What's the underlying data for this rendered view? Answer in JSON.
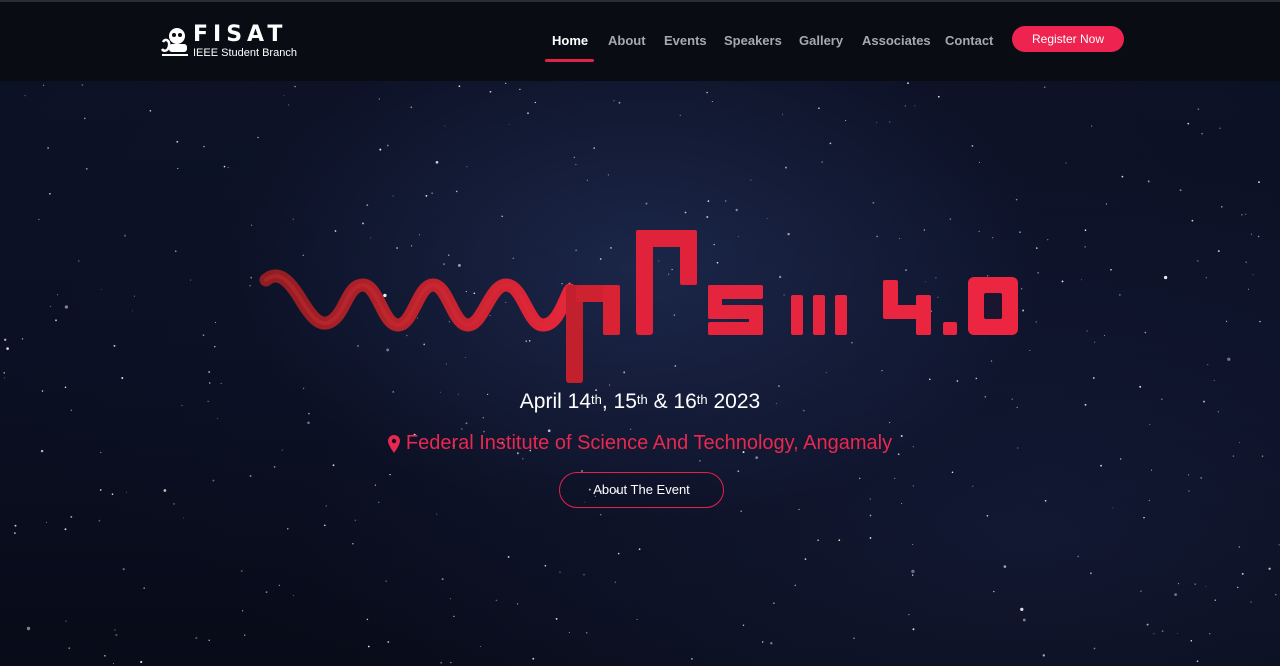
{
  "brand": {
    "name": "FISAT",
    "subtitle": "IEEE Student Branch",
    "logo_icon": "ieee-robot-logo-icon"
  },
  "nav": {
    "items": [
      {
        "label": "Home",
        "active": true
      },
      {
        "label": "About",
        "active": false
      },
      {
        "label": "Events",
        "active": false
      },
      {
        "label": "Speakers",
        "active": false
      },
      {
        "label": "Gallery",
        "active": false
      },
      {
        "label": "Associates",
        "active": false
      },
      {
        "label": "Contact",
        "active": false
      }
    ],
    "register_label": "Register Now"
  },
  "hero": {
    "title_logo_text": "Pulse 4.0",
    "dates": {
      "month": "April",
      "day1": "14",
      "day2": "15",
      "day3": "16",
      "suffix": "th",
      "year": "2023"
    },
    "venue": "Federal Institute of Science And Technology, Angamaly",
    "venue_icon": "map-pin-icon",
    "about_button": "About The Event"
  },
  "colors": {
    "accent": "#ee2350",
    "navbar_bg": "#0a0c14",
    "hero_bg": "#0b1024",
    "nav_text": "#a6a9b3"
  }
}
